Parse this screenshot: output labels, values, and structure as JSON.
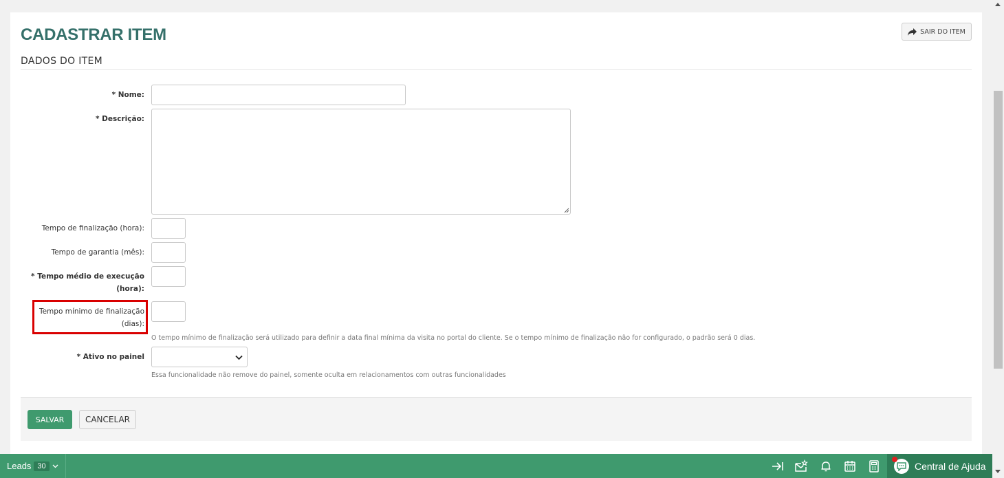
{
  "page": {
    "title": "CADASTRAR ITEM",
    "exit_label": "SAIR DO ITEM",
    "section_title": "DADOS DO ITEM"
  },
  "form": {
    "nome_label": "* Nome:",
    "nome_value": "",
    "descricao_label": "* Descrição:",
    "descricao_value": "",
    "tempo_finalizacao_label": "Tempo de finalização (hora):",
    "tempo_garantia_label": "Tempo de garantia (mês):",
    "tempo_medio_label_line1": "* Tempo médio de execução",
    "tempo_medio_label_line2": "(hora):",
    "tempo_minimo_label_line1": "Tempo mínimo de finalização",
    "tempo_minimo_label_line2": "(dias):",
    "tempo_minimo_hint": "O tempo mínimo de finalização será utilizado para definir a data final mínima da visita no portal do cliente. Se o tempo mínimo de finalização não for configurado, o padrão será 0 dias.",
    "ativo_label": "* Ativo no painel",
    "ativo_value": "",
    "ativo_hint": "Essa funcionalidade não remove do painel, somente oculta em relacionamentos com outras funcionalidades"
  },
  "actions": {
    "save_label": "SALVAR",
    "cancel_label": "CANCELAR"
  },
  "bottombar": {
    "leads_label": "Leads",
    "leads_count": "30",
    "help_label": "Central de Ajuda"
  },
  "colors": {
    "accent": "#3f9a6e",
    "title": "#35706a",
    "highlight": "#d90000"
  }
}
